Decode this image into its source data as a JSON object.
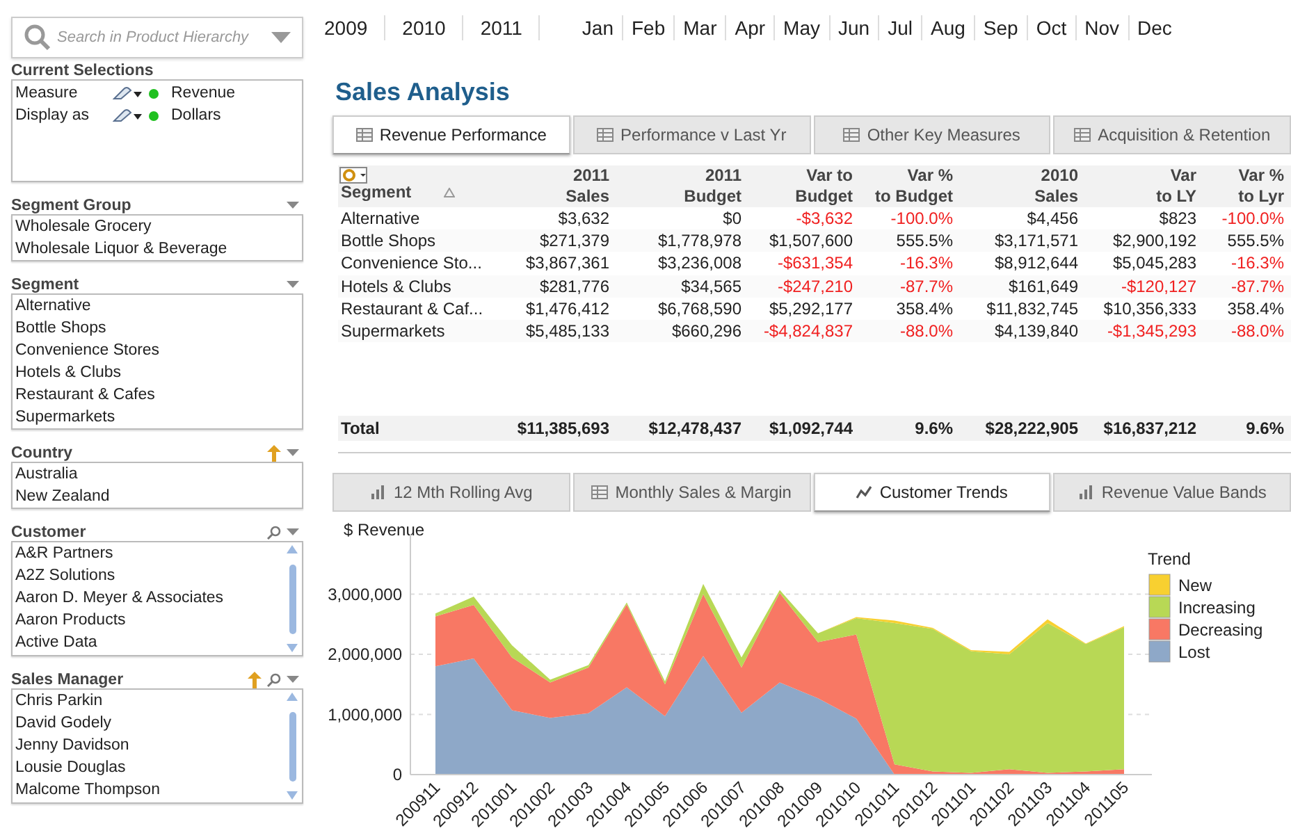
{
  "search": {
    "placeholder": "Search in Product Hierarchy"
  },
  "current_selections": {
    "title": "Current Selections",
    "items": [
      {
        "field": "Measure",
        "value": "Revenue"
      },
      {
        "field": "Display as",
        "value": "Dollars"
      }
    ]
  },
  "list_boxes": [
    {
      "title": "Segment Group",
      "caption_buttons": [
        {
          "kind": "menu"
        }
      ],
      "scroll": false,
      "items": [
        "Wholesale Grocery",
        "Wholesale Liquor & Beverage"
      ]
    },
    {
      "title": "Segment",
      "caption_buttons": [
        {
          "kind": "menu"
        }
      ],
      "scroll": false,
      "items": [
        "Alternative",
        "Bottle Shops",
        "Convenience Stores",
        "Hotels & Clubs",
        "Restaurant & Cafes",
        "Supermarkets"
      ]
    },
    {
      "title": "Country",
      "caption_buttons": [
        {
          "kind": "lock"
        },
        {
          "kind": "menu"
        }
      ],
      "scroll": false,
      "items": [
        "Australia",
        "New Zealand"
      ]
    },
    {
      "title": "Customer",
      "caption_buttons": [
        {
          "kind": "search"
        },
        {
          "kind": "menu"
        }
      ],
      "scroll": true,
      "items": [
        "A&R Partners",
        "A2Z Solutions",
        "Aaron D. Meyer & Associates",
        "Aaron Products",
        "Active Data"
      ]
    },
    {
      "title": "Sales Manager",
      "caption_buttons": [
        {
          "kind": "lock"
        },
        {
          "kind": "search"
        },
        {
          "kind": "menu"
        }
      ],
      "scroll": true,
      "items": [
        "Chris Parkin",
        "David Godely",
        "Jenny Davidson",
        "Lousie Douglas",
        "Malcome Thompson"
      ]
    }
  ],
  "years": [
    {
      "label": "2009",
      "selected": false
    },
    {
      "label": "2010",
      "selected": false
    },
    {
      "label": "2011",
      "selected": false
    }
  ],
  "months": [
    {
      "label": "Jan",
      "selected": false
    },
    {
      "label": "Feb",
      "selected": false
    },
    {
      "label": "Mar",
      "selected": false
    },
    {
      "label": "Apr",
      "selected": false
    },
    {
      "label": "May",
      "selected": false
    },
    {
      "label": "Jun",
      "selected": false
    },
    {
      "label": "Jul",
      "selected": false
    },
    {
      "label": "Aug",
      "selected": false
    },
    {
      "label": "Sep",
      "selected": false
    },
    {
      "label": "Oct",
      "selected": false
    },
    {
      "label": "Nov",
      "selected": false
    },
    {
      "label": "Dec",
      "selected": false
    }
  ],
  "title": "Sales Analysis",
  "table_tabs": [
    {
      "label": "Revenue Performance",
      "selected": true
    },
    {
      "label": "Performance v Last Yr",
      "selected": false
    },
    {
      "label": "Other Key Measures",
      "selected": false
    },
    {
      "label": "Acquisition & Retention",
      "selected": false
    }
  ],
  "table": {
    "columns": [
      "Segment",
      "2011\nSales",
      "2011\nBudget",
      "Var to\nBudget",
      "Var %\nto Budget",
      "2010\nSales",
      "Var\nto LY",
      "Var %\nto Lyr"
    ],
    "rows": [
      [
        {
          "text": "Alternative",
          "negative": false
        },
        {
          "text": "$3,632",
          "negative": false
        },
        {
          "text": "$0",
          "negative": false
        },
        {
          "text": "-$3,632",
          "negative": true
        },
        {
          "text": "-100.0%",
          "negative": true
        },
        {
          "text": "$4,456",
          "negative": false
        },
        {
          "text": "$823",
          "negative": false
        },
        {
          "text": "-100.0%",
          "negative": true
        }
      ],
      [
        {
          "text": "Bottle Shops",
          "negative": false
        },
        {
          "text": "$271,379",
          "negative": false
        },
        {
          "text": "$1,778,978",
          "negative": false
        },
        {
          "text": "$1,507,600",
          "negative": false
        },
        {
          "text": "555.5%",
          "negative": false
        },
        {
          "text": "$3,171,571",
          "negative": false
        },
        {
          "text": "$2,900,192",
          "negative": false
        },
        {
          "text": "555.5%",
          "negative": false
        }
      ],
      [
        {
          "text": "Convenience Sto...",
          "negative": false
        },
        {
          "text": "$3,867,361",
          "negative": false
        },
        {
          "text": "$3,236,008",
          "negative": false
        },
        {
          "text": "-$631,354",
          "negative": true
        },
        {
          "text": "-16.3%",
          "negative": true
        },
        {
          "text": "$8,912,644",
          "negative": false
        },
        {
          "text": "$5,045,283",
          "negative": false
        },
        {
          "text": "-16.3%",
          "negative": true
        }
      ],
      [
        {
          "text": "Hotels & Clubs",
          "negative": false
        },
        {
          "text": "$281,776",
          "negative": false
        },
        {
          "text": "$34,565",
          "negative": false
        },
        {
          "text": "-$247,210",
          "negative": true
        },
        {
          "text": "-87.7%",
          "negative": true
        },
        {
          "text": "$161,649",
          "negative": false
        },
        {
          "text": "-$120,127",
          "negative": true
        },
        {
          "text": "-87.7%",
          "negative": true
        }
      ],
      [
        {
          "text": "Restaurant & Caf...",
          "negative": false
        },
        {
          "text": "$1,476,412",
          "negative": false
        },
        {
          "text": "$6,768,590",
          "negative": false
        },
        {
          "text": "$5,292,177",
          "negative": false
        },
        {
          "text": "358.4%",
          "negative": false
        },
        {
          "text": "$11,832,745",
          "negative": false
        },
        {
          "text": "$10,356,333",
          "negative": false
        },
        {
          "text": "358.4%",
          "negative": false
        }
      ],
      [
        {
          "text": "Supermarkets",
          "negative": false
        },
        {
          "text": "$5,485,133",
          "negative": false
        },
        {
          "text": "$660,296",
          "negative": false
        },
        {
          "text": "-$4,824,837",
          "negative": true
        },
        {
          "text": "-88.0%",
          "negative": true
        },
        {
          "text": "$4,139,840",
          "negative": false
        },
        {
          "text": "-$1,345,293",
          "negative": true
        },
        {
          "text": "-88.0%",
          "negative": true
        }
      ]
    ],
    "total": [
      "Total",
      "$11,385,693",
      "$12,478,437",
      "$1,092,744",
      "9.6%",
      "$28,222,905",
      "$16,837,212",
      "9.6%"
    ]
  },
  "chart_tabs": [
    {
      "label": "12 Mth Rolling Avg",
      "selected": false,
      "kind": "bar"
    },
    {
      "label": "Monthly Sales & Margin",
      "selected": false,
      "kind": "table"
    },
    {
      "label": "Customer Trends",
      "selected": true,
      "kind": "line"
    },
    {
      "label": "Revenue Value Bands",
      "selected": false,
      "kind": "bar"
    }
  ],
  "chart": {
    "chart_data": {
      "type": "area",
      "stacked": true,
      "grid": true,
      "ylabel": "$ Revenue",
      "legend": {
        "title": "Trend"
      },
      "categories": [
        "200911",
        "200912",
        "201001",
        "201002",
        "201003",
        "201004",
        "201005",
        "201006",
        "201007",
        "201008",
        "201009",
        "201010",
        "201011",
        "201012",
        "201101",
        "201102",
        "201103",
        "201104",
        "201105"
      ],
      "ylim": [
        0,
        4000000
      ],
      "yticks": [
        {
          "value": 0,
          "label": "0"
        },
        {
          "value": 1000000,
          "label": "1,000,000"
        },
        {
          "value": 2000000,
          "label": "2,000,000"
        },
        {
          "value": 3000000,
          "label": "3,000,000"
        }
      ],
      "series": [
        {
          "name": "Lost",
          "color": "#8ea8c8",
          "values": [
            1800000,
            1930000,
            1070000,
            940000,
            1020000,
            1450000,
            970000,
            1970000,
            1030000,
            1530000,
            1270000,
            930000,
            0,
            0,
            0,
            0,
            0,
            0,
            0
          ]
        },
        {
          "name": "Decreasing",
          "color": "#f87864",
          "values": [
            830000,
            890000,
            880000,
            590000,
            760000,
            1380000,
            530000,
            1030000,
            750000,
            1490000,
            930000,
            1400000,
            170000,
            50000,
            30000,
            90000,
            30000,
            50000,
            90000
          ]
        },
        {
          "name": "Increasing",
          "color": "#b8d855",
          "values": [
            50000,
            140000,
            200000,
            50000,
            40000,
            30000,
            50000,
            170000,
            170000,
            50000,
            150000,
            270000,
            2350000,
            2370000,
            2020000,
            1910000,
            2490000,
            2120000,
            2360000
          ]
        },
        {
          "name": "New",
          "color": "#f8d030",
          "values": [
            0,
            0,
            0,
            0,
            0,
            0,
            0,
            0,
            0,
            0,
            0,
            20000,
            40000,
            20000,
            20000,
            40000,
            60000,
            10000,
            20000
          ]
        }
      ]
    }
  }
}
